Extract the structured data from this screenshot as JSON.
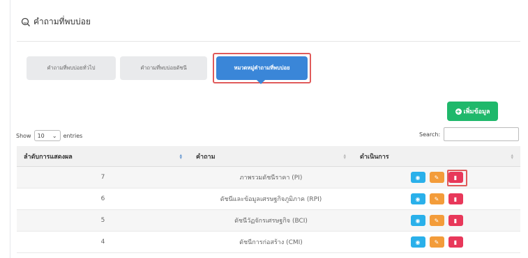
{
  "header": {
    "title": "คำถามที่พบบ่อย",
    "icon": "chat-icon"
  },
  "tabs": [
    {
      "label": "คำถามที่พบบ่อยทั่วไป",
      "active": false
    },
    {
      "label": "คำถามที่พบบ่อยดัชนี",
      "active": false
    },
    {
      "label": "หมวดหมู่คำถามที่พบบ่อย",
      "active": true
    }
  ],
  "add_button": {
    "label": "เพิ่มข้อมูล",
    "icon": "plus-circle-icon"
  },
  "length_menu": {
    "prefix": "Show",
    "value": "10",
    "suffix": "entries"
  },
  "search": {
    "label": "Search:",
    "value": ""
  },
  "table": {
    "headers": [
      "ลำดับการแสดงผล",
      "คำถาม",
      "ดำเนินการ"
    ],
    "rows": [
      {
        "order": "7",
        "question": "ภาพรวมดัชนีราคา (PI)"
      },
      {
        "order": "6",
        "question": "ดัชนีและข้อมูลเศรษฐกิจภูมิภาค (RPI)"
      },
      {
        "order": "5",
        "question": "ดัชนีวัฏจักรเศรษฐกิจ (BCI)"
      },
      {
        "order": "4",
        "question": "ดัชนีการก่อสร้าง (CMI)"
      }
    ]
  },
  "colors": {
    "view": "#2ab0ea",
    "edit": "#f39c3a",
    "delete": "#e8385a",
    "primary": "#3a86d8",
    "success": "#1fb86b",
    "highlight": "#e05a5a"
  }
}
